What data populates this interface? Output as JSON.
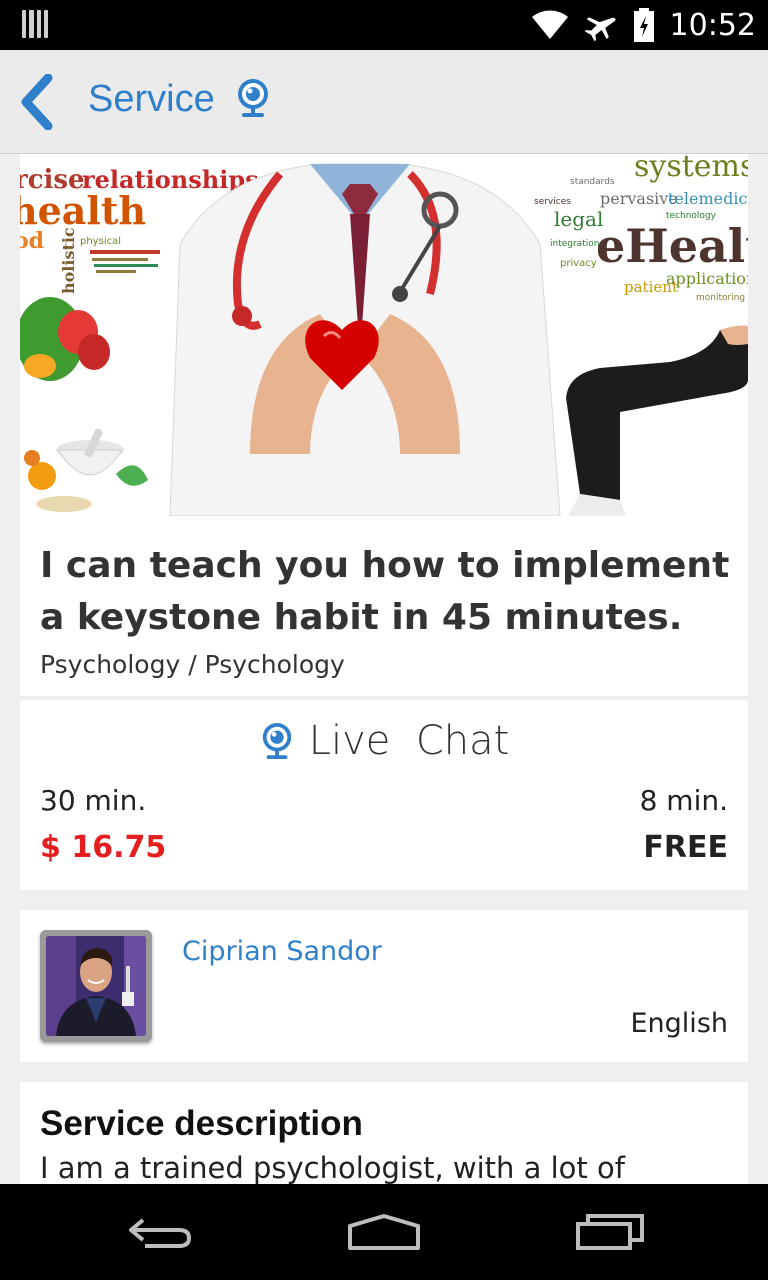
{
  "status_bar": {
    "time": "10:52",
    "icons": [
      "notification-icon",
      "wifi-icon",
      "airplane-mode-icon",
      "battery-icon"
    ]
  },
  "app_bar": {
    "title": "Service",
    "icons": [
      "back-arrow-icon",
      "webcam-icon"
    ],
    "accent_color": "#2f7fcb"
  },
  "hero": {
    "word_cloud_left": [
      "relationships",
      "rcise",
      "health",
      "od",
      "holistic",
      "physical"
    ],
    "word_cloud_right": [
      "systems",
      "pervasive",
      "telemedicine",
      "legal",
      "eHealth",
      "applications",
      "patient",
      "privacy",
      "monitoring",
      "integration",
      "services",
      "standards",
      "technology"
    ]
  },
  "service": {
    "title": "I can teach you how to implement a keystone habit in 45 minutes.",
    "category": "Psychology / Psychology"
  },
  "live_chat": {
    "label": "Live  Chat",
    "icon": "webcam-icon",
    "duration_left": "30 min.",
    "price_left": "$ 16.75",
    "duration_right": "8 min.",
    "price_right": "FREE",
    "price_color": "#e41e1e"
  },
  "expert": {
    "name": "Ciprian Sandor",
    "language": "English"
  },
  "description": {
    "heading": "Service description",
    "text": "I am a trained psychologist, with a lot of"
  },
  "nav_bar": {
    "icons": [
      "back-nav-icon",
      "home-nav-icon",
      "recent-apps-icon"
    ]
  }
}
